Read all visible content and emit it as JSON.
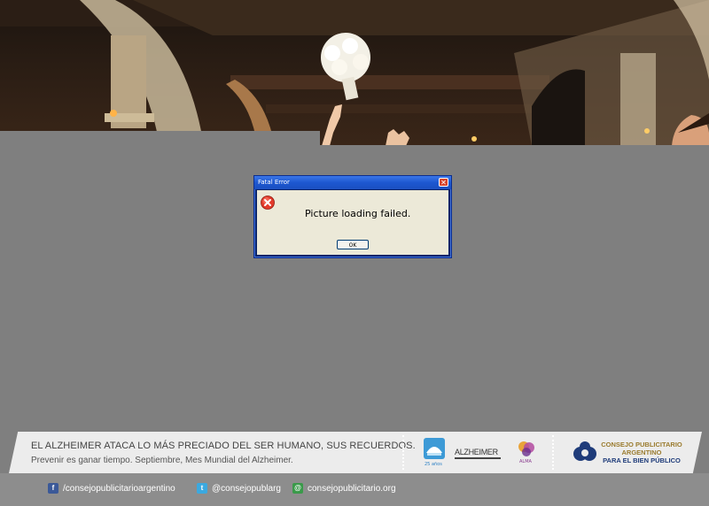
{
  "dialog": {
    "title": "Fatal Error",
    "close_symbol": "✕",
    "message": "Picture loading failed.",
    "ok_label": "OK",
    "icon": "error-icon"
  },
  "banner": {
    "headline": "EL ALZHEIMER ATACA LO MÁS PRECIADO DEL SER HUMANO, SUS RECUERDOS.",
    "subline": "Prevenir es ganar tiempo. Septiembre, Mes Mundial del Alzheimer.",
    "logos": {
      "alpa_label": "25 años",
      "alzheimer_label": "ALZHEIMER",
      "alma_label": "ALMA",
      "cpa_line1": "CONSEJO PUBLICITARIO",
      "cpa_line2": "ARGENTINO",
      "cpa_line3": "PARA EL BIEN PÚBLICO"
    }
  },
  "footer": {
    "facebook": "/consejopublicitarioargentino",
    "twitter": "@consejopublarg",
    "website": "consejopublicitario.org"
  },
  "colors": {
    "page_grey": "#7f7f7f",
    "xp_title_blue": "#1d57d0",
    "cpa_gold": "#9a7b2e",
    "cpa_blue": "#1f3c7a"
  }
}
